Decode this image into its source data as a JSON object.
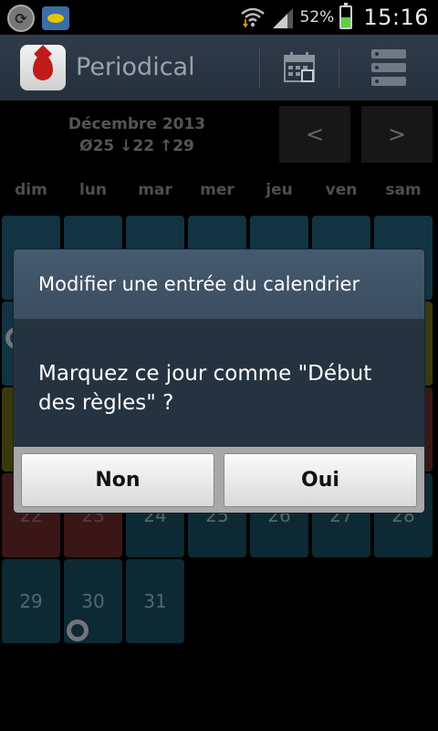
{
  "status_bar": {
    "battery_pct": "52%",
    "battery_level": 0.52,
    "time": "15:16",
    "icons": [
      "sync-icon",
      "notification-icon",
      "wifi-icon",
      "signal-icon",
      "battery-icon"
    ]
  },
  "action_bar": {
    "app_name": "Periodical",
    "icons": [
      "app-logo-icon",
      "calendar-icon",
      "list-icon"
    ]
  },
  "calendar": {
    "month_title": "Décembre 2013",
    "stats": "Ø25 ↓22 ↑29",
    "prev_label": "<",
    "next_label": ">",
    "weekdays": [
      "dim",
      "lun",
      "mar",
      "mer",
      "jeu",
      "ven",
      "sam"
    ],
    "days": {
      "d22": "22",
      "d23": "23",
      "d24": "24",
      "d25": "25",
      "d26": "26",
      "d27": "27",
      "d28": "28",
      "d29": "29",
      "d30": "30",
      "d31": "31"
    }
  },
  "dialog": {
    "title": "Modifier une entrée du calendrier",
    "message": "Marquez ce jour comme \"Début des règles\" ?",
    "no_label": "Non",
    "yes_label": "Oui"
  },
  "colors": {
    "accent_teal": "#1f5e78",
    "period_red": "#6b2a2a",
    "fertile_olive": "#686b16",
    "dialog_title_bg": "#465a6e",
    "dialog_body_bg": "#253340"
  }
}
